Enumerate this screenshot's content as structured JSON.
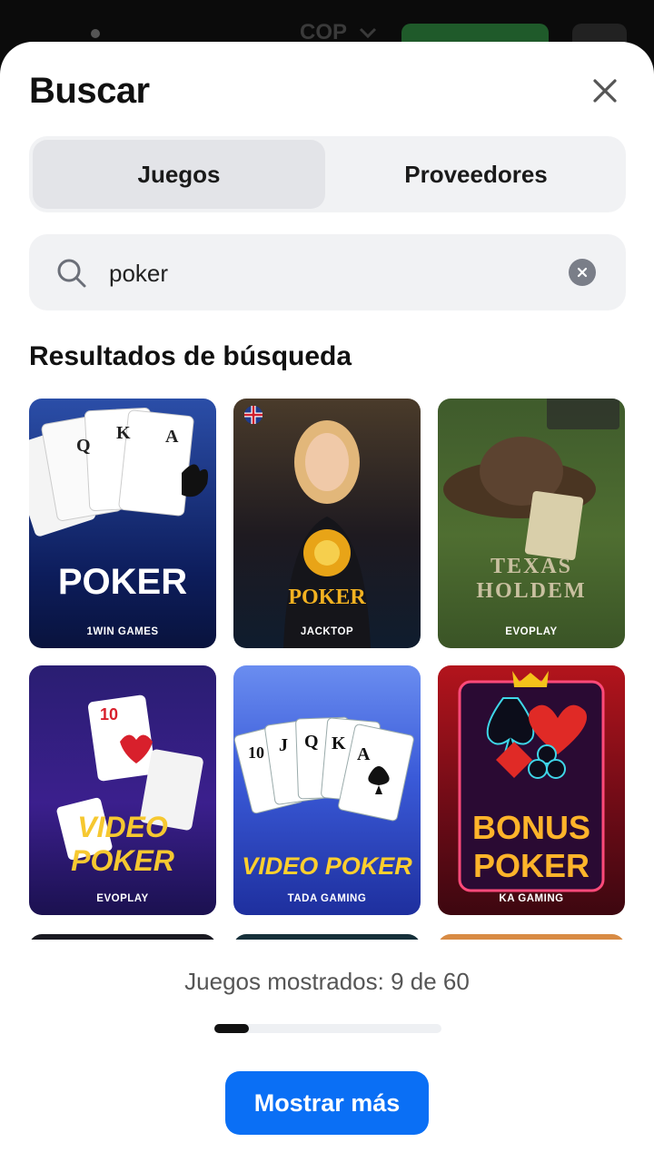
{
  "topbar": {
    "currency": "COP"
  },
  "modal": {
    "title": "Buscar",
    "tabs": [
      {
        "label": "Juegos",
        "active": true
      },
      {
        "label": "Proveedores",
        "active": false
      }
    ],
    "search": {
      "value": "poker"
    },
    "results_title": "Resultados de búsqueda"
  },
  "games": [
    {
      "title": "POKER",
      "provider": "1WIN GAMES"
    },
    {
      "title": "POKER",
      "provider": "JACKTOP"
    },
    {
      "title": "TEXAS HOLDEM",
      "provider": "EVOPLAY"
    },
    {
      "title": "VIDEO POKER",
      "provider": "EVOPLAY"
    },
    {
      "title": "VIDEO POKER",
      "provider": "TADA GAMING"
    },
    {
      "title": "BONUS POKER",
      "provider": "KA GAMING"
    }
  ],
  "footer": {
    "count_text": "Juegos mostrados: 9 de 60",
    "progress_fraction": 0.15,
    "button_label": "Mostrar más"
  },
  "colors": {
    "accent": "#0a6ff5"
  }
}
